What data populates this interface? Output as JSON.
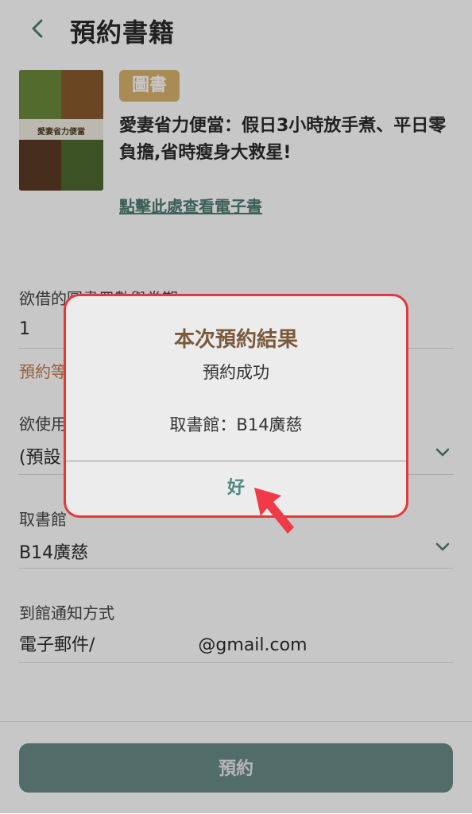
{
  "header": {
    "title": "預約書籍"
  },
  "book": {
    "tag": "圖書",
    "title": "愛妻省力便當：假日3小時放手煮、平日零負擔,省時瘦身大救星!",
    "cover_text": "愛妻省力便當",
    "ebook_link": "點擊此處查看電子書"
  },
  "form": {
    "volume_label": "欲借的圖書冊數與卷期",
    "volume_value": "1",
    "hint": "預約等",
    "card_label": "欲使用",
    "card_value": "(預設",
    "library_label": "取書館",
    "library_value": "B14廣慈",
    "notify_label": "到館通知方式",
    "notify_prefix": "電子郵件/",
    "notify_suffix": "@gmail.com"
  },
  "submit_label": "預約",
  "dialog": {
    "title": "本次預約結果",
    "message": "預約成功",
    "library": "取書館：B14廣慈",
    "ok": "好"
  },
  "colors": {
    "accent": "#4f8b82",
    "tag": "#d9b36e",
    "highlight_border": "#e23a3a",
    "button": "#6a8b87"
  }
}
